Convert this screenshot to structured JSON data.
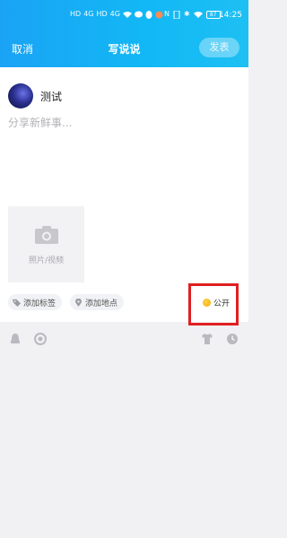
{
  "statusbar": {
    "left_glyphs": [
      "HD",
      "4G",
      "HD",
      "4G"
    ],
    "right_glyphs": [
      "N",
      "⚡",
      "✱"
    ],
    "battery": "87",
    "time": "14:25"
  },
  "navbar": {
    "cancel_label": "取消",
    "title": "写说说",
    "post_label": "发表"
  },
  "user": {
    "name": "测试"
  },
  "composer": {
    "placeholder": "分享新鲜事..."
  },
  "media": {
    "label": "照片/视频"
  },
  "chips": {
    "tags_label": "添加标签",
    "location_label": "添加地点",
    "visibility_label": "公开"
  },
  "colors": {
    "header_start": "#1aa3f5",
    "header_end": "#1ec0f3",
    "highlight_border": "#e02020",
    "public_icon": "#f2a700"
  },
  "toolbar_icons": [
    "qq-penguin-icon",
    "camera-aperture-icon",
    "shirt-icon",
    "clock-icon"
  ]
}
